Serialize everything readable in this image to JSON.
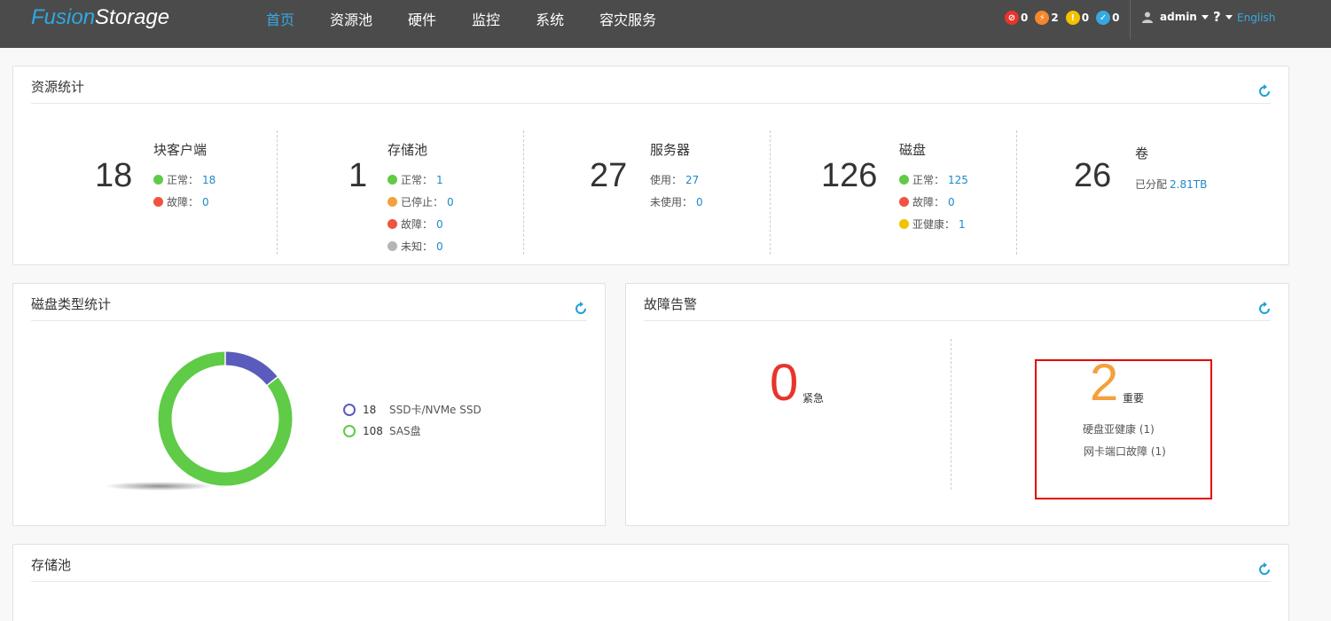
{
  "header": {
    "logo_part1": "Fusion",
    "logo_part2": "Storage",
    "nav": [
      {
        "label": "首页",
        "active": true
      },
      {
        "label": "资源池"
      },
      {
        "label": "硬件"
      },
      {
        "label": "监控"
      },
      {
        "label": "系统"
      },
      {
        "label": "容灾服务"
      }
    ],
    "alerts": [
      {
        "icon": "critical-alarm-icon",
        "count": "0",
        "color": "#e8342b"
      },
      {
        "icon": "major-alarm-icon",
        "count": "2",
        "color": "#f5862c"
      },
      {
        "icon": "minor-alarm-icon",
        "count": "0",
        "color": "#f2c200"
      },
      {
        "icon": "warning-alarm-icon",
        "count": "0",
        "color": "#36a9e1"
      }
    ],
    "user": "admin",
    "help": "?",
    "language": "English"
  },
  "resource_stats": {
    "title": "资源统计",
    "block_clients": {
      "count": "18",
      "title": "块客户端",
      "normal_label": "正常：",
      "normal": "18",
      "fault_label": "故障：",
      "fault": "0"
    },
    "pools": {
      "count": "1",
      "title": "存储池",
      "normal_label": "正常：",
      "normal": "1",
      "stopped_label": "已停止：",
      "stopped": "0",
      "fault_label": "故障：",
      "fault": "0",
      "unknown_label": "未知：",
      "unknown": "0"
    },
    "servers": {
      "count": "27",
      "title": "服务器",
      "used_label": "使用：",
      "used": "27",
      "unused_label": "未使用：",
      "unused": "0"
    },
    "disks": {
      "count": "126",
      "title": "磁盘",
      "normal_label": "正常：",
      "normal": "125",
      "fault_label": "故障：",
      "fault": "0",
      "subhealth_label": "亚健康：",
      "subhealth": "1"
    },
    "volumes": {
      "count": "26",
      "title": "卷",
      "allocated_label": "已分配",
      "allocated": "2.81TB"
    }
  },
  "disk_types": {
    "title": "磁盘类型统计",
    "legend": [
      {
        "count": "18",
        "label": "SSD卡/NVMe SSD",
        "color": "#5b5bbd"
      },
      {
        "count": "108",
        "label": "SAS盘",
        "color": "#5fcb47"
      }
    ]
  },
  "alarms": {
    "title": "故障告警",
    "critical": {
      "count": "0",
      "label": "紧急",
      "color": "#e8342b"
    },
    "major": {
      "count": "2",
      "label": "重要",
      "color": "#f5a03d"
    },
    "major_items": [
      "硬盘亚健康 (1)",
      "网卡端口故障 (1)"
    ]
  },
  "storage_pool": {
    "title": "存储池"
  },
  "colors": {
    "green": "#5fcb47",
    "red": "#f0533f",
    "orange": "#f5a03d",
    "yellow": "#f2c200",
    "gray": "#b5b5b5",
    "link": "#1e89c8"
  }
}
